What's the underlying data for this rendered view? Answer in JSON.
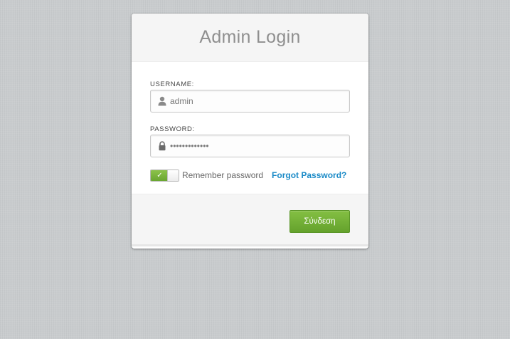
{
  "login": {
    "title": "Admin Login",
    "username": {
      "label": "USERNAME:",
      "value": "admin",
      "icon": "user-icon"
    },
    "password": {
      "label": "PASSWORD:",
      "value": "•••••••••••••",
      "icon": "lock-icon"
    },
    "remember": {
      "label": "Remember password",
      "checked": true,
      "check_glyph": "✓"
    },
    "forgot_label": "Forgot Password?",
    "submit_label": "Σύνδεση"
  },
  "colors": {
    "accent_green": "#6aa631",
    "link_blue": "#1a8ac7",
    "background": "#c9ccce"
  }
}
